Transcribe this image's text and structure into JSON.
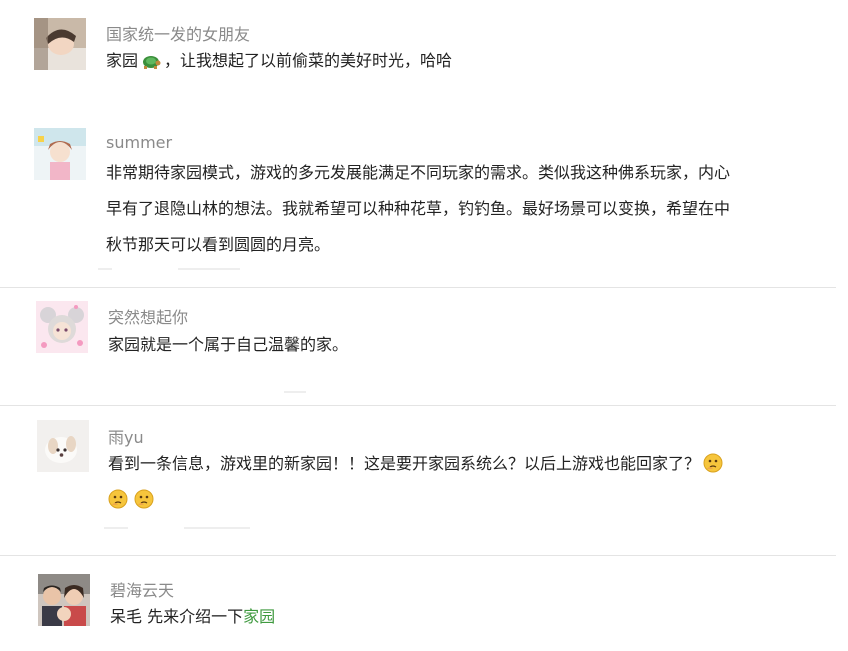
{
  "comments": [
    {
      "username": "国家统一发的女朋友",
      "text_before_emoji": "家园",
      "emoji": "turtle-emoji",
      "text_after_emoji": "，让我想起了以前偷菜的美好时光，哈哈"
    },
    {
      "username": "summer",
      "lines": [
        "非常期待家园模式，游戏的多元发展能满足不同玩家的需求。类似我这种佛系玩家，内心",
        "早有了退隐山林的想法。我就希望可以种种花草，钓钓鱼。最好场景可以变换，希望在中",
        "秋节那天可以看到圆圆的月亮。"
      ]
    },
    {
      "username": "突然想起你",
      "text": "家园就是一个属于自己温馨的家。"
    },
    {
      "username": "雨yu",
      "text": "看到一条信息，游戏里的新家园！！这是要开家园系统么？以后上游戏也能回家了？",
      "emoji": "thinking-face-emoji"
    },
    {
      "username": "碧海云天",
      "text_plain": "呆毛  先来介绍一下",
      "text_link": "家园"
    }
  ],
  "colors": {
    "username": "#8a8a8a",
    "body_text": "#222222",
    "link": "#3f9a3f",
    "divider": "#e4e4e4"
  }
}
